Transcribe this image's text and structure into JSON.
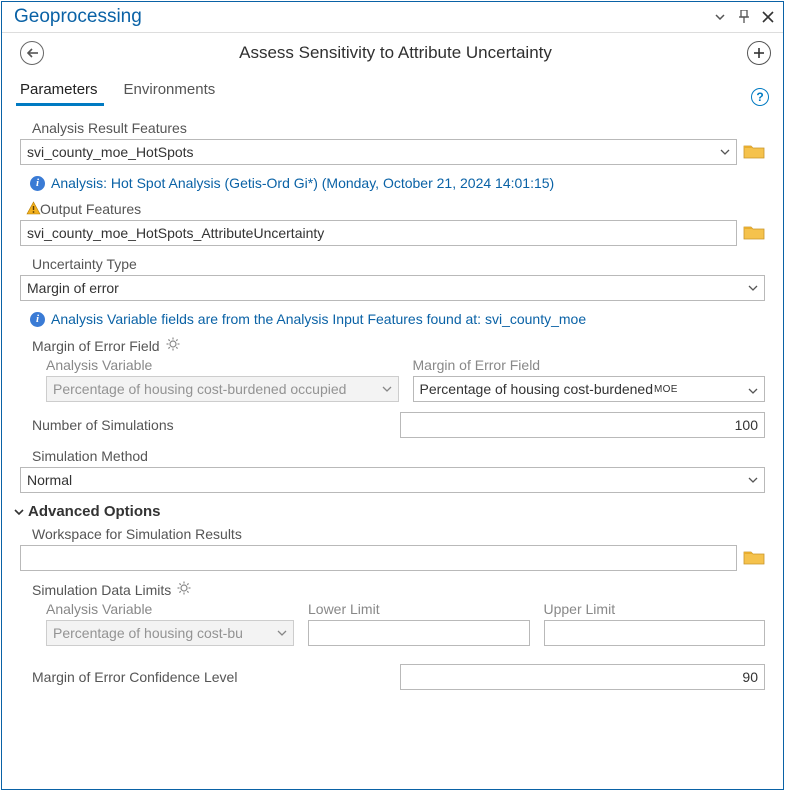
{
  "window": {
    "title": "Geoprocessing"
  },
  "tool": {
    "title": "Assess Sensitivity to Attribute Uncertainty"
  },
  "tabs": {
    "t0": "Parameters",
    "t1": "Environments"
  },
  "params": {
    "analysisResultFeatures": {
      "label": "Analysis Result Features",
      "value": "svi_county_moe_HotSpots"
    },
    "analysisInfo": "Analysis: Hot Spot Analysis (Getis-Ord Gi*) (Monday, October 21, 2024 14:01:15)",
    "outputFeatures": {
      "label": "Output Features",
      "value": "svi_county_moe_HotSpots_AttributeUncertainty"
    },
    "uncertaintyType": {
      "label": "Uncertainty Type",
      "value": "Margin of error"
    },
    "variableInfo": "Analysis Variable fields are from the Analysis Input Features found at: svi_county_moe",
    "moeField": {
      "label": "Margin of Error Field",
      "analysisVarLabel": "Analysis Variable",
      "analysisVarValue": "Percentage of housing cost-burdened occupied",
      "moeFieldLabel": "Margin of Error Field",
      "moeFieldValue": "Percentage of housing cost-burdened",
      "moeFieldSuffix": "MOE"
    },
    "numSimulations": {
      "label": "Number of Simulations",
      "value": "100"
    },
    "simMethod": {
      "label": "Simulation Method",
      "value": "Normal"
    }
  },
  "adv": {
    "header": "Advanced Options",
    "workspace": {
      "label": "Workspace for Simulation Results",
      "value": ""
    },
    "limits": {
      "label": "Simulation Data Limits",
      "analysisVarLabel": "Analysis Variable",
      "analysisVarValue": "Percentage of housing cost-bu",
      "lowerLabel": "Lower Limit",
      "lowerValue": "",
      "upperLabel": "Upper Limit",
      "upperValue": ""
    },
    "moeConf": {
      "label": "Margin of Error Confidence Level",
      "value": "90"
    }
  }
}
